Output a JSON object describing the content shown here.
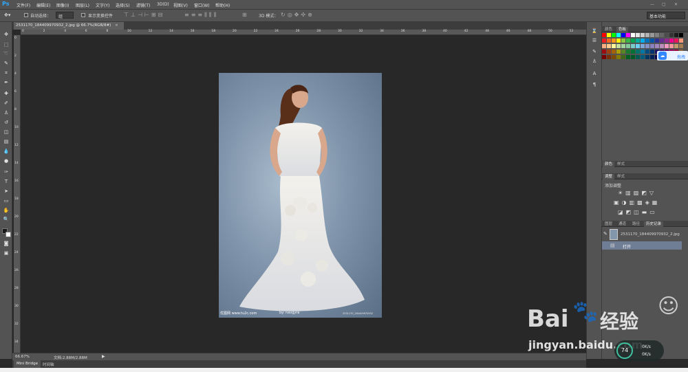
{
  "app": {
    "logo": "Ps",
    "menus": [
      "文件(F)",
      "编辑(E)",
      "图像(I)",
      "图层(L)",
      "文字(Y)",
      "选择(S)",
      "滤镜(T)",
      "3D(D)",
      "视图(V)",
      "窗口(W)",
      "帮助(H)"
    ]
  },
  "options": {
    "auto_select_label": "自动选择：",
    "auto_select_value": "组",
    "show_transform_label": "显示变换控件",
    "mode_3d_label": "3D 模式：",
    "workspace": "基本功能"
  },
  "document": {
    "tab_title": "2531170_184409970932_2.jpg @ 66.7%(RGB/8#)",
    "ruler_ticks": [
      "0",
      "2",
      "4",
      "6",
      "8",
      "10",
      "12",
      "14",
      "16",
      "18",
      "20",
      "22",
      "24",
      "26",
      "28",
      "30",
      "32",
      "34",
      "36",
      "38",
      "40",
      "42",
      "44",
      "46",
      "48",
      "50",
      "52"
    ],
    "vruler_ticks": [
      "0",
      "2",
      "4",
      "6",
      "8",
      "10",
      "12",
      "14",
      "16",
      "18",
      "20",
      "22",
      "24",
      "26",
      "28",
      "30",
      "32",
      "34"
    ],
    "photo_caption_left": "优图网 www.tu2c.com",
    "photo_caption_mid": "by: navgyra",
    "photo_caption_right": "2531170_184409970932"
  },
  "status": {
    "zoom": "66.67%",
    "doc_size": "文档:2.88M/2.88M"
  },
  "bottom_tabs": [
    "Mini Bridge",
    "时间轴"
  ],
  "panels": {
    "swatch_tabs": [
      "颜色",
      "色板"
    ],
    "style_tabs": [
      "颜色",
      "样式"
    ],
    "adjust_tabs": [
      "调整",
      "样式"
    ],
    "adjust_title": "添加调整",
    "layer_tabs": [
      "图层",
      "通道",
      "路径",
      "历史记录"
    ],
    "history_snapshot": "2531170_184409970932_2.jpg",
    "history_step": "打开"
  },
  "baidu_chip": "拖拽",
  "watermark": {
    "brand": "Bai",
    "brand_suffix": "经验",
    "url": "jingyan.baidu.com"
  },
  "speed_widget": {
    "percent": "74",
    "up": "0K/s",
    "down": "0K/s"
  },
  "swatch_colors": [
    "#ff0000",
    "#ffff00",
    "#00ff00",
    "#00ffff",
    "#0000ff",
    "#ff00ff",
    "#ffffff",
    "#e6e6e6",
    "#cccccc",
    "#b3b3b3",
    "#999999",
    "#808080",
    "#666666",
    "#4d4d4d",
    "#333333",
    "#1a1a1a",
    "#000000",
    "#ed1c24",
    "#f26522",
    "#f7941d",
    "#fff200",
    "#8dc63f",
    "#39b54a",
    "#00a651",
    "#00a99d",
    "#00aeef",
    "#0072bc",
    "#0054a6",
    "#2e3192",
    "#662d91",
    "#92278f",
    "#ec008c",
    "#ed145b",
    "#f7977a",
    "#f9ad81",
    "#fdc68a",
    "#fff79a",
    "#c4df9b",
    "#a3d39c",
    "#82ca9c",
    "#7accc8",
    "#6dcff6",
    "#7da7d9",
    "#8393ca",
    "#8781bd",
    "#a187be",
    "#bd8cbf",
    "#f49ac2",
    "#f6989d",
    "#c69c6d",
    "#a67c52",
    "#9e0b0f",
    "#a0410d",
    "#a36209",
    "#aba000",
    "#598527",
    "#1a7b30",
    "#007236",
    "#00746b",
    "#0076a3",
    "#004b80",
    "#003471",
    "#1b1464",
    "#440e62",
    "#630460",
    "#9e005d",
    "#9e0039",
    "#8c6239",
    "#790000",
    "#7b2e00",
    "#7d4900",
    "#827b00",
    "#406618",
    "#005e20",
    "#005826",
    "#005952",
    "#005b7f",
    "#003663",
    "#002157",
    "#0d004c",
    "#32004b",
    "#4b0049",
    "#7b0046",
    "#7a0026",
    "#754c24"
  ]
}
